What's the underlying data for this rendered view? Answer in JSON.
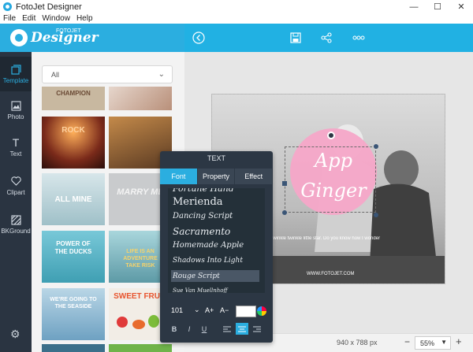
{
  "window": {
    "title": "FotoJet Designer",
    "controls": {
      "minimize": "—",
      "maximize": "☐",
      "close": "✕"
    }
  },
  "menu": [
    "File",
    "Edit",
    "Window",
    "Help"
  ],
  "header": {
    "brand_small": "FOTOJET",
    "brand": "Designer",
    "icons": [
      "back-icon",
      "save-icon",
      "share-icon",
      "more-icon"
    ]
  },
  "rail": {
    "items": [
      {
        "label": "Template",
        "icon": "template-icon"
      },
      {
        "label": "Photo",
        "icon": "photo-icon"
      },
      {
        "label": "Text",
        "icon": "text-icon"
      },
      {
        "label": "Clipart",
        "icon": "heart-icon"
      },
      {
        "label": "BKGround",
        "icon": "background-icon"
      }
    ],
    "settings_icon": "gear-icon"
  },
  "panel": {
    "dropdown_value": "All",
    "thumbnails": [
      {
        "text": "CHAMPION",
        "color": "#c8b8a0"
      },
      {
        "text": "",
        "color": "#d9c9b9"
      },
      {
        "text": "ROCK",
        "color": "#7a2a1a"
      },
      {
        "text": "",
        "color": "#6b4a2a"
      },
      {
        "text": "ALL MINE",
        "color": "#aac7cf"
      },
      {
        "text": "MARRY ME",
        "color": "#c4c7c9"
      },
      {
        "text": "POWER OF THE DUCKS",
        "color": "#5cb6c9"
      },
      {
        "text": "LIFE IS AN ADVENTURE TAKE RISK",
        "color": "#6fa8b4"
      },
      {
        "text": "WE'RE GOING TO THE SEASIDE",
        "color": "#8fb9cc"
      },
      {
        "text": "SWEET FRUIT",
        "color": "#f2ede6"
      }
    ]
  },
  "canvas": {
    "heading_line1": "App",
    "heading_line2": "Ginger",
    "caption": "Twinkle twinkle little star. Do you know how I wonder",
    "website": "WWW.FOTOJET.COM",
    "size_label": "940 x 788 px",
    "zoom": "55%",
    "zoom_minus": "−",
    "zoom_plus": "+"
  },
  "text_panel": {
    "title": "TEXT",
    "tabs": [
      {
        "label": "Font",
        "active": true
      },
      {
        "label": "Property",
        "active": false
      },
      {
        "label": "Effect",
        "active": false
      }
    ],
    "fonts": [
      {
        "name": "Fortune Hand",
        "selected": false
      },
      {
        "name": "Merienda",
        "selected": false
      },
      {
        "name": "Dancing Script",
        "selected": false
      },
      {
        "name": "Sacramento",
        "selected": false
      },
      {
        "name": "Homemade Apple",
        "selected": false
      },
      {
        "name": "Shadows Into Light",
        "selected": false
      },
      {
        "name": "Rouge Script",
        "selected": true
      },
      {
        "name": "Sue Van Muellnhoff",
        "selected": false
      }
    ],
    "font_size": "101",
    "size_up": "A+",
    "size_down": "A−",
    "color": "#ffffff",
    "style_buttons": [
      "B",
      "I",
      "U"
    ],
    "align_buttons": [
      "align-left-icon",
      "align-center-icon",
      "align-right-icon"
    ],
    "active_align": "align-center-icon"
  },
  "colors": {
    "accent": "#2baee0",
    "rail_bg": "#2a3441",
    "pink_circle": "#f5a6c8"
  }
}
